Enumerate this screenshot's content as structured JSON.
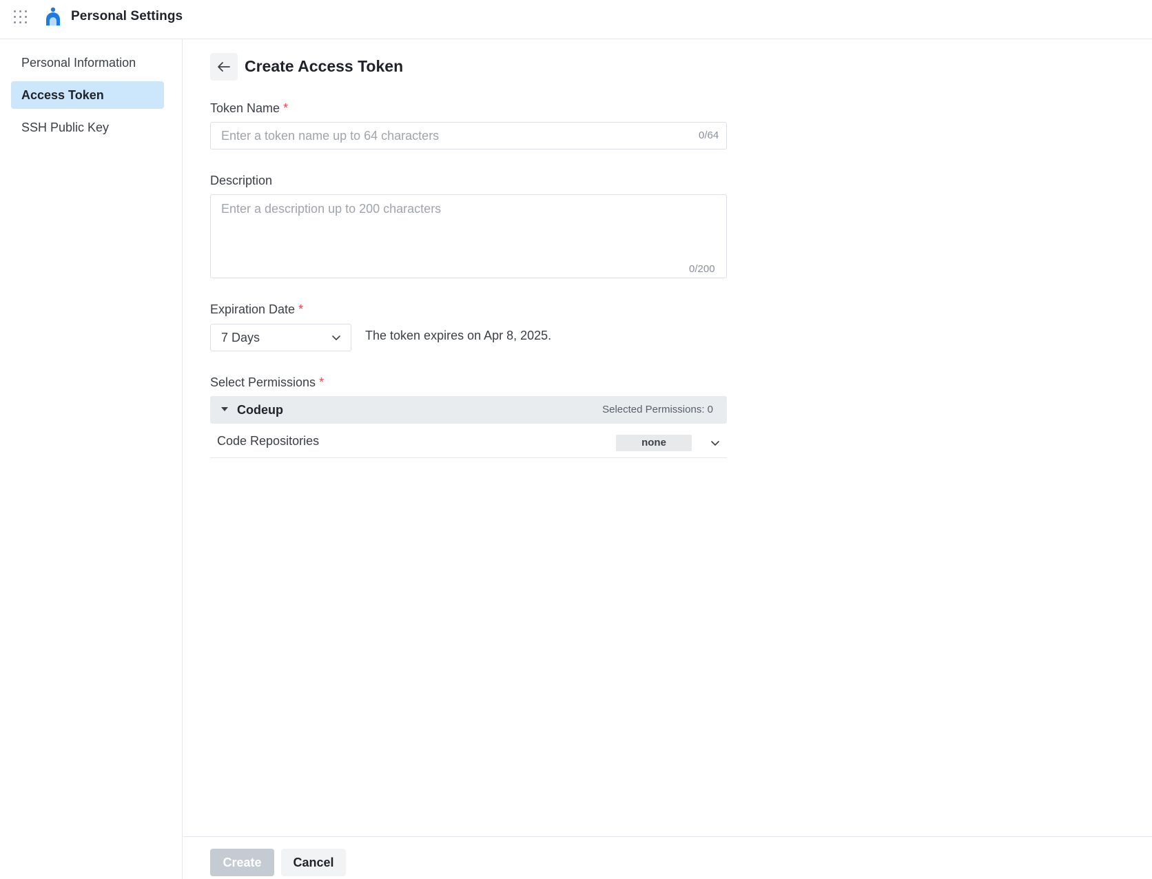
{
  "header": {
    "app_title": "Personal Settings",
    "apps_icon": "apps-grid-icon",
    "logo_icon": "person-logo-icon",
    "brand_color": "#1e7be0"
  },
  "sidebar": {
    "items": [
      {
        "label": "Personal Information",
        "active": false
      },
      {
        "label": "Access Token",
        "active": true
      },
      {
        "label": "SSH Public Key",
        "active": false
      }
    ],
    "active_bg": "#cce7fb"
  },
  "page": {
    "title": "Create Access Token",
    "back_icon": "arrow-left-icon"
  },
  "form": {
    "token_name": {
      "label": "Token Name",
      "required_mark": "*",
      "value": "",
      "placeholder": "Enter a token name up to 64 characters",
      "counter": "0/64"
    },
    "description": {
      "label": "Description",
      "value": "",
      "placeholder": "Enter a description up to 200 characters",
      "counter": "0/200"
    },
    "expiration": {
      "label": "Expiration Date",
      "required_mark": "*",
      "selected": "7 Days",
      "note": "The token expires on Apr 8, 2025."
    },
    "permissions": {
      "label": "Select Permissions",
      "required_mark": "*",
      "groups": [
        {
          "name": "Codeup",
          "selected_text": "Selected Permissions: 0",
          "items": [
            {
              "name": "Code Repositories",
              "level": "none"
            }
          ]
        }
      ]
    }
  },
  "footer": {
    "create_label": "Create",
    "cancel_label": "Cancel"
  }
}
